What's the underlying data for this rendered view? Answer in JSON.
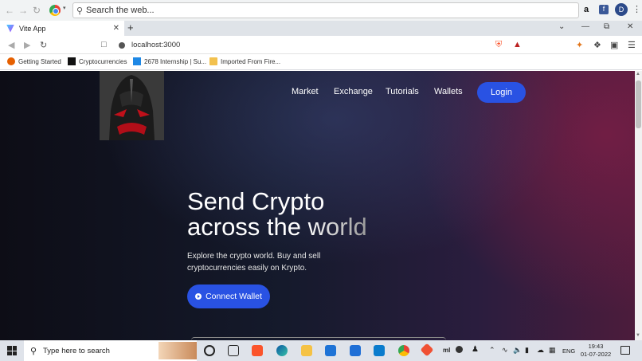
{
  "os_browser_bar": {
    "search_placeholder": "Search the web..."
  },
  "tab": {
    "title": "Vite App"
  },
  "address": {
    "url": "localhost:3000"
  },
  "bookmarks": [
    {
      "label": "Getting Started"
    },
    {
      "label": "Cryptocurrencies"
    },
    {
      "label": "2678 Internship | Su..."
    },
    {
      "label": "Imported From Fire..."
    }
  ],
  "site": {
    "nav": [
      "Market",
      "Exchange",
      "Tutorials",
      "Wallets"
    ],
    "login_label": "Login",
    "headline_line1": "Send Crypto",
    "headline_line2_a": "across ",
    "headline_line2_b": "the world",
    "subtext": "Explore the crypto world. Buy and sell cryptocurrencies easily on Krypto.",
    "connect_label": "Connect Wallet"
  },
  "taskbar": {
    "search_placeholder": "Type here to search",
    "lang": "ENG",
    "time": "19:43",
    "date": "01-07-2022"
  },
  "colors": {
    "accent": "#2952e3",
    "page_bg_left": "#0d0d16",
    "page_bg_right": "#4c1c3c"
  }
}
